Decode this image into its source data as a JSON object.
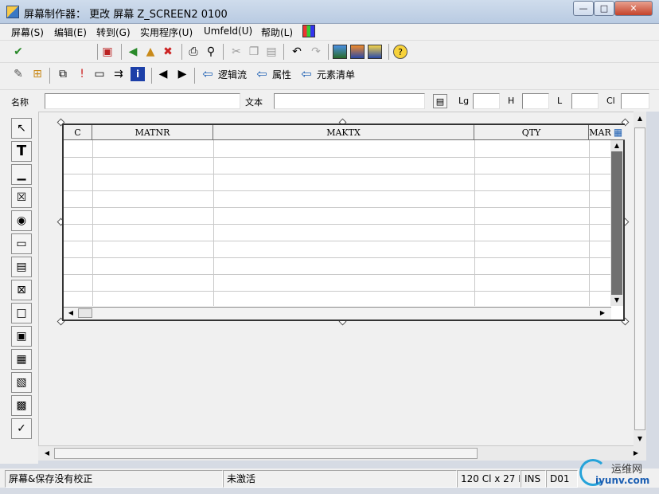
{
  "window": {
    "title": "屏幕制作器： 更改 屏幕 Z_SCREEN2 0100",
    "minimize_label": "—",
    "maximize_label": "□",
    "close_label": "✕"
  },
  "menu": [
    "屏幕(S)",
    "编辑(E)",
    "转到(G)",
    "实用程序(U)",
    "Umfeld(U)",
    "帮助(L)"
  ],
  "toolbar2": {
    "logic_flow": "逻辑流",
    "attributes": "属性",
    "element_list": "元素清单"
  },
  "attributes": {
    "name_label": "名称",
    "text_label": "文本",
    "lg_label": "Lg",
    "h_label": "H",
    "l_label": "L",
    "cl_label": "Cl"
  },
  "grid": {
    "columns": [
      "C",
      "MATNR",
      "MAKTX",
      "QTY",
      "MAR"
    ]
  },
  "status": {
    "message": "屏幕&保存没有校正",
    "mode": "未激活",
    "size": "120 Cl x 27 L",
    "ins": "INS",
    "code": "D01"
  },
  "watermark": {
    "brand": "运维网",
    "url": "iyunv.com"
  },
  "colors": {
    "accent": "#1c5fb3",
    "grid_scroll_thumb": "#707070"
  }
}
